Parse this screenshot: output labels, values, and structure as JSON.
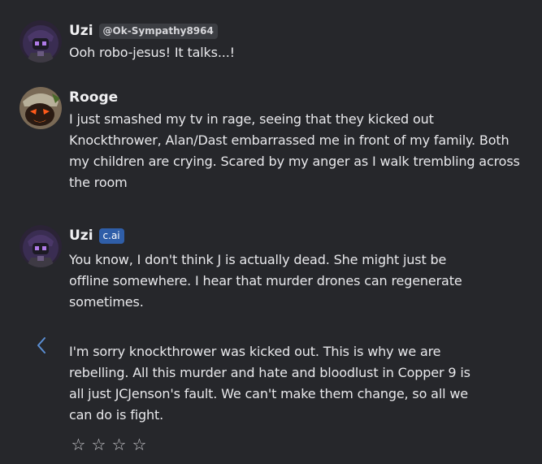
{
  "messages": [
    {
      "name": "Uzi",
      "handle": "@Ok-Sympathy8964",
      "text": "Ooh robo-jesus! It talks...!"
    },
    {
      "name": "Rooge",
      "text_lines": [
        "I just smashed my tv in rage, seeing that they kicked out",
        "Knockthrower, Alan/Dast embarrassed me in front of my family. Both",
        "my children are crying. Scared by my anger as I walk trembling across",
        "the room"
      ]
    },
    {
      "name": "Uzi",
      "tag": "c.ai",
      "text_lines": [
        "You know, I don't think J is actually dead. She might just be",
        "offline somewhere. I hear that murder drones can regenerate",
        "sometimes."
      ]
    }
  ],
  "alternate_reply": {
    "text_lines": [
      "I'm sorry knockthrower was kicked out. This is why we are",
      "rebelling. All this murder and hate and bloodlust in Copper 9 is",
      "all just JCJenson's fault. We can't make them change, so all we",
      "can do is fight."
    ]
  },
  "rating": {
    "stars": [
      "☆",
      "☆",
      "☆",
      "☆"
    ]
  },
  "icons": {
    "prev": "chevron-left-icon",
    "star": "star-outline-icon"
  },
  "colors": {
    "background": "#26272b",
    "tag": "#2f5ea8",
    "chevron": "#5b8fd4"
  }
}
